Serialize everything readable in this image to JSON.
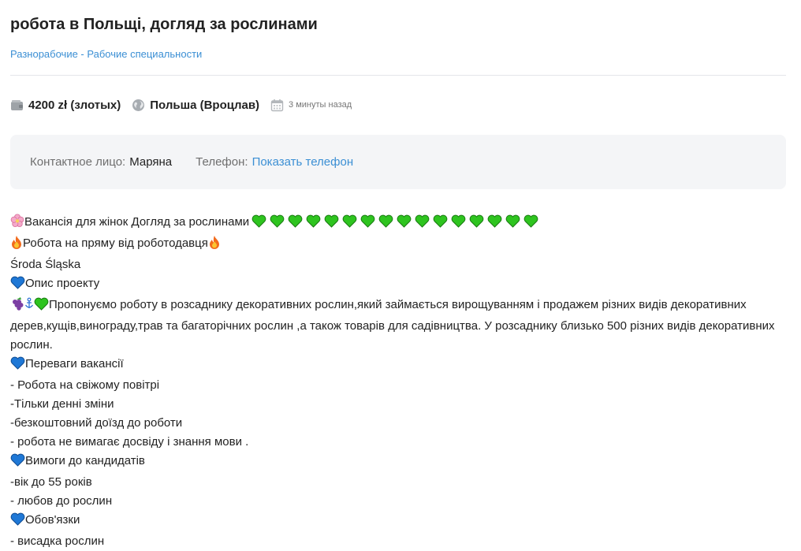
{
  "title": "робота в Польщі, догляд за рослинами",
  "category": "Разнорабочие - Рабочие специальности",
  "meta": {
    "salary": "4200 zł (злотых)",
    "location": "Польша (Вроцлав)",
    "posted": "3 минуты назад",
    "icons": [
      "wallet-icon",
      "globe-icon",
      "calendar-icon"
    ]
  },
  "contact": {
    "person_label": "Контактное лицо:",
    "person_name": "Маряна",
    "phone_label": "Телефон:",
    "phone_link": "Показать телефон"
  },
  "colors": {
    "link": "#3b8fd4",
    "heart_green": "#2ec41f",
    "heart_blue": "#1f78d6",
    "contact_bg": "#f4f5f7"
  },
  "description": {
    "l1": "Вакансія для жінок Догляд за рослинами",
    "l1_heart_count": 16,
    "l2": "Робота на пряму від роботодавця",
    "l3": "Środa Śląska",
    "l4": "Опис проекту",
    "l5": "Пропонуємо роботу в розсаднику декоративних рослин,який займається вирощуванням і продажем різних видів декоративних дерев,кущів,винограду,трав та багаторічних рослин ,а також товарів для садівництва. У розсаднику близько 500 різних видів декоративних рослин.",
    "l6": "Переваги вакансії",
    "l7": "- Робота на свіжому повітрі",
    "l8": "-Тільки денні зміни",
    "l9": "-безкоштовний доїзд до роботи",
    "l10": "- робота не вимагає досвіду і знання мови .",
    "l11": "Вимоги до кандидатів",
    "l12": "-вік до 55 років",
    "l13": "- любов до рослин",
    "l14": "Обов'язки",
    "l15": "- висадка рослин"
  }
}
